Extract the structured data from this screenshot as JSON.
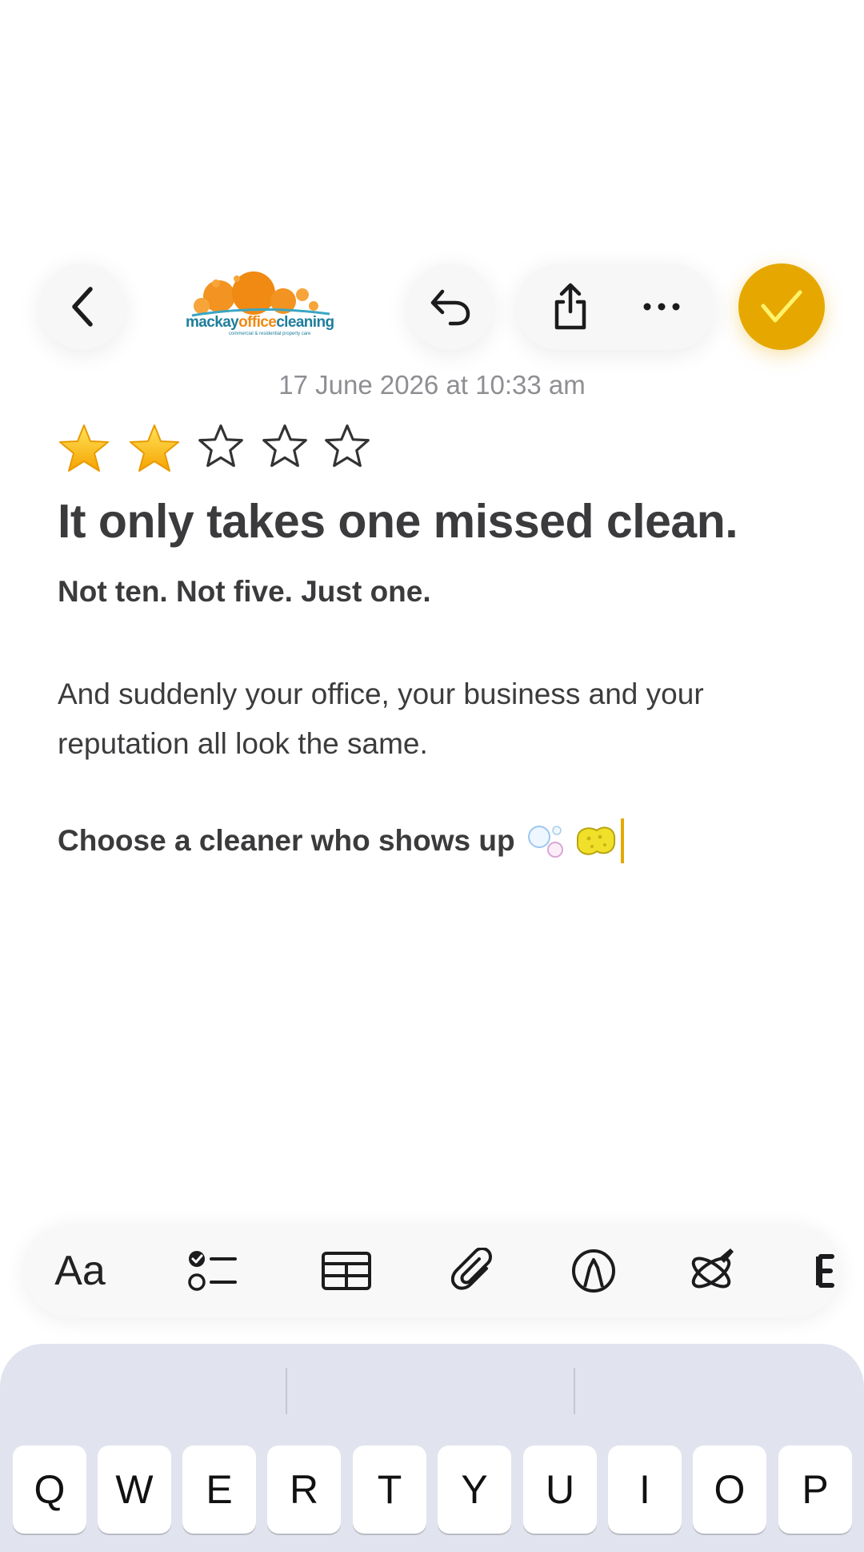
{
  "toolbar_top": {
    "back_icon": "chevron-left-icon",
    "undo_icon": "undo-icon",
    "share_icon": "share-icon",
    "more_icon": "ellipsis-icon",
    "done_icon": "checkmark-icon",
    "accent_color": "#e6a800"
  },
  "logo": {
    "word1": "mackay",
    "word2": "office",
    "word3": "cleaning",
    "tagline": "commercial & residential property care"
  },
  "note": {
    "date": "17 June 2026 at 10:33 am",
    "rating": {
      "filled": 2,
      "total": 5
    },
    "title": "It only takes one missed clean.",
    "subtitle": "Not ten. Not five. Just one.",
    "paragraph": "And suddenly your office, your business and your reputation all look the same.",
    "cta": "Choose a cleaner who shows up"
  },
  "format_toolbar": {
    "text_style_label": "Aa",
    "tools": [
      "text-style-icon",
      "checklist-icon",
      "table-icon",
      "attachment-icon",
      "markup-icon",
      "writing-tools-icon"
    ]
  },
  "keyboard": {
    "row1": [
      "Q",
      "W",
      "E",
      "R",
      "T",
      "Y",
      "U",
      "I",
      "O",
      "P"
    ]
  }
}
